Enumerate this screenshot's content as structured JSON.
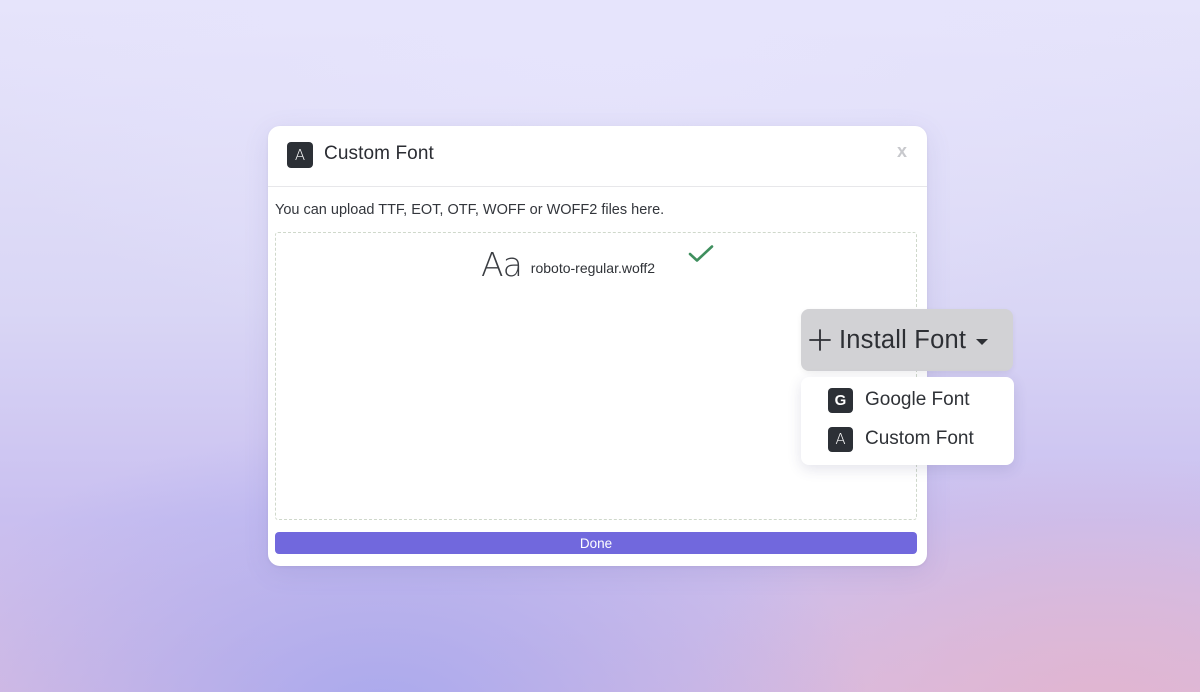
{
  "dialog": {
    "title": "Custom Font",
    "badge_glyph": "A",
    "close_label": "x",
    "hint": "You can upload TTF, EOT, OTF, WOFF or WOFF2 files here.",
    "uploaded_file": {
      "preview_glyph": "Aa",
      "name": "roboto-regular.woff2",
      "status": "uploaded",
      "status_icon": "check-icon"
    },
    "done_label": "Done"
  },
  "install_menu": {
    "button_label": "Install Font",
    "button_icon": "plus-icon",
    "items": [
      {
        "label": "Google Font",
        "badge_glyph": "G",
        "icon": "google-icon"
      },
      {
        "label": "Custom Font",
        "badge_glyph": "A",
        "icon": "custom-font-icon"
      }
    ]
  },
  "colors": {
    "accent": "#7168dd",
    "success": "#3f8f5e",
    "badge": "#2c3036",
    "install_button_bg": "#d2d2d5"
  }
}
